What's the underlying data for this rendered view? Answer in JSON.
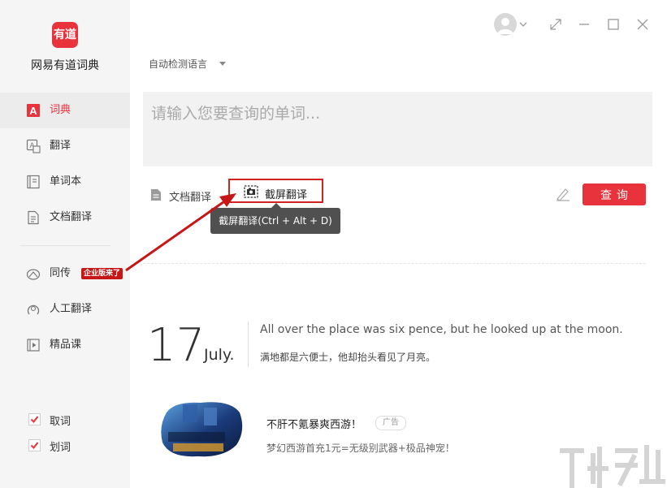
{
  "app": {
    "logo_text": "有道",
    "name": "网易有道词典"
  },
  "sidebar": {
    "items": [
      {
        "label": "词典",
        "icon": "dictionary-icon",
        "active": true
      },
      {
        "label": "翻译",
        "icon": "translate-icon",
        "active": false
      },
      {
        "label": "单词本",
        "icon": "wordbook-icon",
        "active": false
      },
      {
        "label": "文档翻译",
        "icon": "document-icon",
        "active": false
      },
      {
        "label": "同传",
        "icon": "simultaneous-icon",
        "active": false,
        "badge": "企业版来了"
      },
      {
        "label": "人工翻译",
        "icon": "human-translate-icon",
        "active": false
      },
      {
        "label": "精品课",
        "icon": "course-icon",
        "active": false
      }
    ],
    "toggles": [
      {
        "label": "取词",
        "checked": true
      },
      {
        "label": "划词",
        "checked": true
      }
    ]
  },
  "query": {
    "language": "自动检测语言",
    "placeholder": "请输入您要查询的单词...",
    "value": ""
  },
  "tools": {
    "doc_translate": "文档翻译",
    "screenshot_translate": "截屏翻译",
    "tooltip": "截屏翻译(Ctrl + Alt + D)",
    "search": "查询"
  },
  "daily": {
    "day": "17",
    "month": "July.",
    "sentence_en": "All over the place was six pence, but he looked up at the moon.",
    "sentence_zh": "满地都是六便士，他却抬头看见了月亮。"
  },
  "ad": {
    "title": "不肝不氪暴爽西游！",
    "tag": "广告",
    "description": "梦幻西游首充1元=无级别武器+极品神宠！"
  },
  "colors": {
    "accent": "#e8323c",
    "annotation_red": "#d32222",
    "sidebar_bg": "#f5f5f5"
  }
}
